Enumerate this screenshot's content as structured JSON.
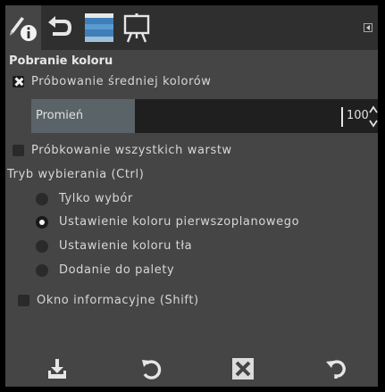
{
  "tabs": [
    {
      "name": "tool-options",
      "icon": "pencil-info-icon"
    },
    {
      "name": "undo-history",
      "icon": "undo-arrow-icon"
    },
    {
      "name": "images",
      "icon": "image-thumbnail-icon"
    },
    {
      "name": "templates",
      "icon": "easel-icon"
    }
  ],
  "tab_menu_icon": "tab-menu-icon",
  "section_title": "Pobranie koloru",
  "sample_average": {
    "label": "Próbowanie średniej kolorów",
    "checked": true
  },
  "radius": {
    "label": "Promień",
    "value": "100",
    "fill_percent": 30
  },
  "sample_merged": {
    "label": "Próbkowanie wszystkich warstw",
    "checked": false
  },
  "pick_mode": {
    "label": "Tryb wybierania  (Ctrl)",
    "options": [
      {
        "label": "Tylko wybór",
        "selected": false
      },
      {
        "label": "Ustawienie koloru pierwszoplanowego",
        "selected": true
      },
      {
        "label": "Ustawienie koloru tła",
        "selected": false
      },
      {
        "label": "Dodanie do palety",
        "selected": false
      }
    ]
  },
  "info_window": {
    "label": "Okno informacyjne  (Shift)",
    "checked": false
  },
  "bottom_buttons": [
    {
      "icon": "save-icon"
    },
    {
      "icon": "restore-icon"
    },
    {
      "icon": "delete-icon"
    },
    {
      "icon": "reset-icon"
    }
  ],
  "colors": {
    "panel": "#454545",
    "tabbar": "#2f2f2f",
    "slider_fill": "#5a6468",
    "text": "#d7d7d7"
  }
}
